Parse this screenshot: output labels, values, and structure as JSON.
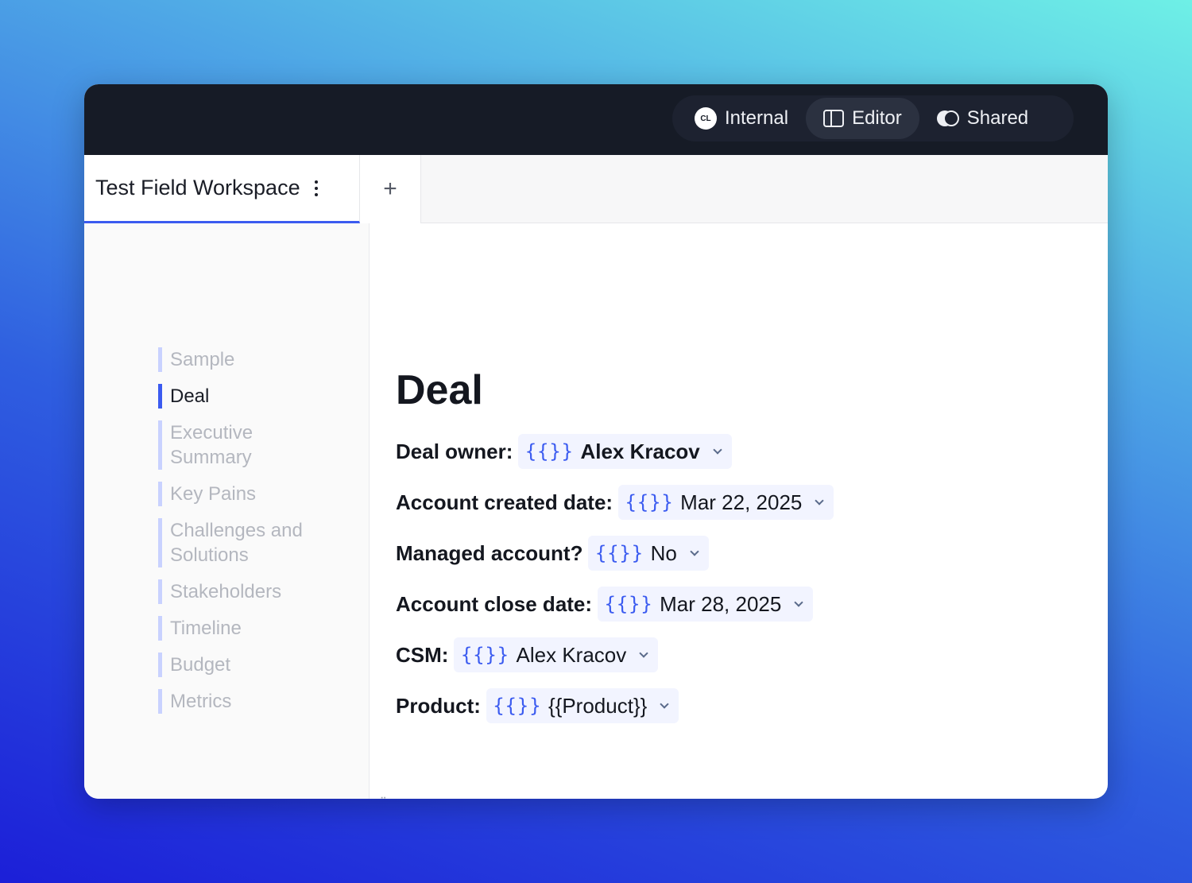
{
  "topbar": {
    "modes": [
      {
        "label": "Internal",
        "badge": "CL"
      },
      {
        "label": "Editor"
      },
      {
        "label": "Shared"
      }
    ]
  },
  "tabs": {
    "active_label": "Test Field Workspace",
    "add_label": "+"
  },
  "sidebar": {
    "items": [
      {
        "label": "Sample"
      },
      {
        "label": "Deal"
      },
      {
        "label": "Executive Summary"
      },
      {
        "label": "Key Pains"
      },
      {
        "label": "Challenges and Solutions"
      },
      {
        "label": "Stakeholders"
      },
      {
        "label": "Timeline"
      },
      {
        "label": "Budget"
      },
      {
        "label": "Metrics"
      }
    ]
  },
  "content": {
    "heading": "Deal",
    "brace": "{{}}",
    "fields": [
      {
        "label": "Deal owner:",
        "value": "Alex Kracov"
      },
      {
        "label": "Account created date:",
        "value": "Mar 22, 2025"
      },
      {
        "label": "Managed account?",
        "value": "No"
      },
      {
        "label": "Account close date:",
        "value": "Mar 28, 2025"
      },
      {
        "label": "CSM:",
        "value": "Alex Kracov"
      },
      {
        "label": "Product:",
        "value": "{{Product}}"
      }
    ]
  },
  "colors": {
    "accent": "#3b5bf0",
    "topbar": "#161b26"
  }
}
